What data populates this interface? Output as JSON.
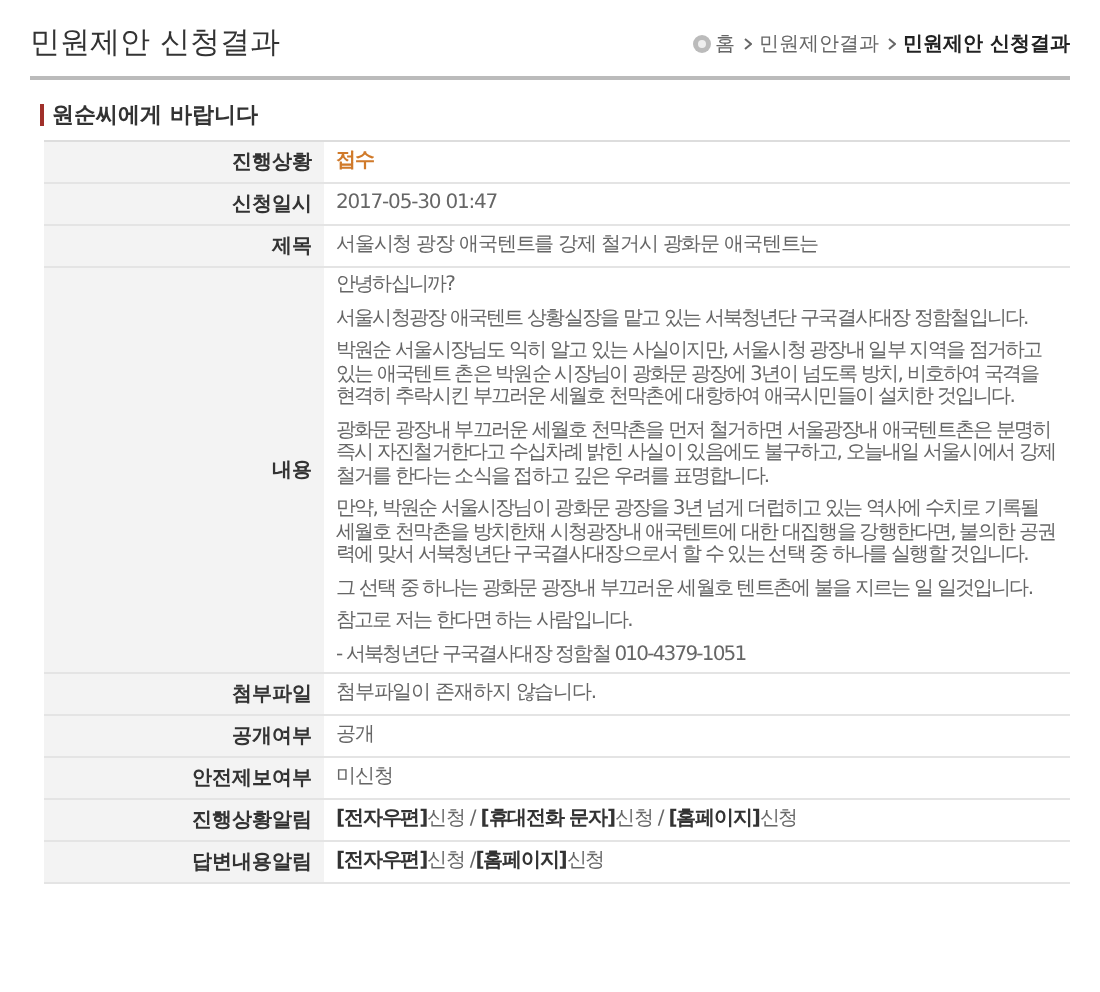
{
  "page_title": "민원제안 신청결과",
  "breadcrumb": [
    {
      "label": "홈",
      "current": false
    },
    {
      "label": "민원제안결과",
      "current": false
    },
    {
      "label": "민원제안 신청결과",
      "current": true
    }
  ],
  "section_title": "원순씨에게 바랍니다",
  "rows": [
    {
      "kind": "status",
      "label": "진행상황",
      "value": "접수"
    },
    {
      "kind": "text",
      "label": "신청일시",
      "value": "2017-05-30 01:47"
    },
    {
      "kind": "text",
      "label": "제목",
      "value": "서울시청 광장 애국텐트를 강제 철거시 광화문 애국텐트는"
    },
    {
      "kind": "paragraphs",
      "label": "내용",
      "paragraphs": [
        "안녕하십니까?",
        "서울시청광장 애국텐트 상황실장을 맡고 있는 서북청년단 구국결사대장 정함철입니다.",
        "박원순 서울시장님도 익히 알고 있는 사실이지만, 서울시청 광장내 일부 지역을 점거하고 있는 애국텐트 촌은 박원순 시장님이 광화문 광장에 3년이 넘도록 방치, 비호하여 국격을 현격히 추락시킨 부끄러운 세월호 천막촌에 대항하여 애국시민들이 설치한 것입니다.",
        "광화문 광장내 부끄러운 세월호 천막촌을 먼저 철거하면 서울광장내 애국텐트촌은 분명히 즉시 자진철거한다고 수십차례 밝힌 사실이 있음에도 불구하고, 오늘내일 서울시에서 강제 철거를 한다는 소식을 접하고 깊은 우려를 표명합니다.",
        "만약, 박원순 서울시장님이 광화문 광장을 3년 넘게 더럽히고 있는 역사에 수치로 기록될 세월호 천막촌을 방치한채 시청광장내 애국텐트에 대한 대집행을 강행한다면, 불의한 공권력에 맞서 서북청년단 구국결사대장으로서 할 수 있는 선택 중 하나를 실행할 것입니다.",
        "그 선택 중 하나는 광화문 광장내 부끄러운 세월호 텐트촌에 불을 지르는 일 일것입니다.",
        "참고로 저는 한다면 하는 사람입니다.",
        "- 서북청년단 구국결사대장 정함철 010-4379-1051"
      ]
    },
    {
      "kind": "text",
      "label": "첨부파일",
      "value": "첨부파일이 존재하지 않습니다."
    },
    {
      "kind": "text",
      "label": "공개여부",
      "value": "공개"
    },
    {
      "kind": "text",
      "label": "안전제보여부",
      "value": "미신청"
    },
    {
      "kind": "text",
      "label": "진행상황알림",
      "value": "**[전자우편]**신청 / **[휴대전화 문자]**신청 / **[홈페이지]**신청"
    },
    {
      "kind": "text",
      "label": "답변내용알림",
      "value": "**[전자우편]**신청 /**[홈페이지]**신청"
    }
  ]
}
